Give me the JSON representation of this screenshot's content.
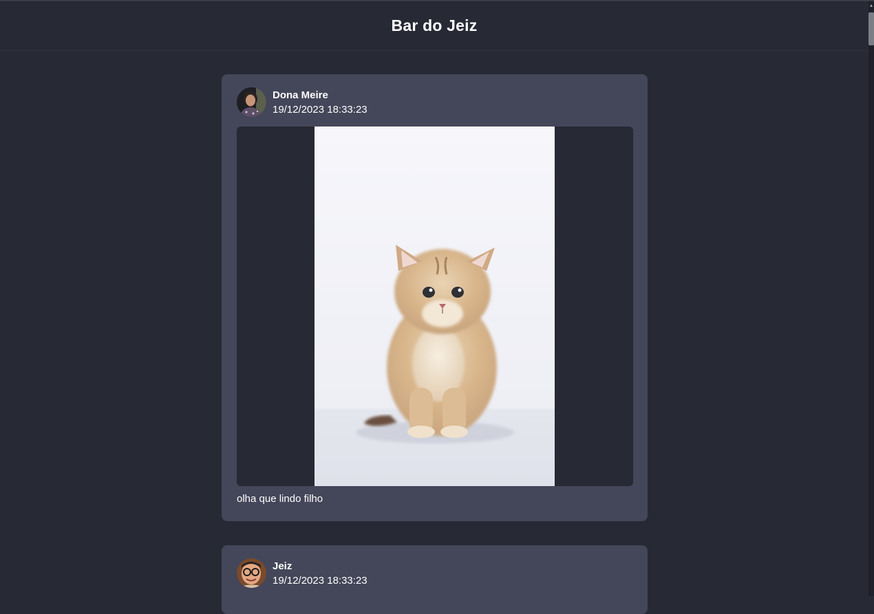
{
  "header": {
    "title": "Bar do Jeiz"
  },
  "posts": [
    {
      "author": "Dona Meire",
      "date": "19/12/2023 18:33:23",
      "caption": "olha que lindo filho",
      "avatar_icon": "woman-portrait-avatar",
      "image": "fluffy-kitten-photo"
    },
    {
      "author": "Jeiz",
      "date": "19/12/2023 18:33:23",
      "avatar_icon": "man-glasses-portrait-avatar"
    }
  ],
  "colors": {
    "background": "#272935",
    "card": "#444659",
    "text": "#ffffff"
  }
}
